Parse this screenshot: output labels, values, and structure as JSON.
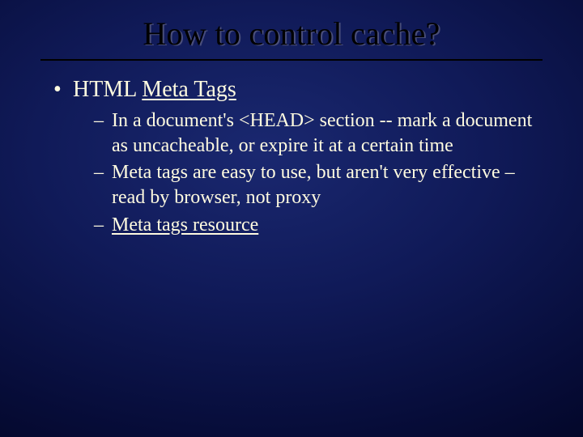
{
  "title": "How to control cache?",
  "l1": {
    "item0": {
      "prefix": "HTML ",
      "link": "Meta Tags"
    }
  },
  "l2": {
    "item0": "In a document's <HEAD> section -- mark a document as uncacheable, or expire it at a certain time",
    "item1": "Meta tags are easy to use, but aren't very effective – read by browser, not proxy",
    "item2_link": "Meta tags resource"
  }
}
